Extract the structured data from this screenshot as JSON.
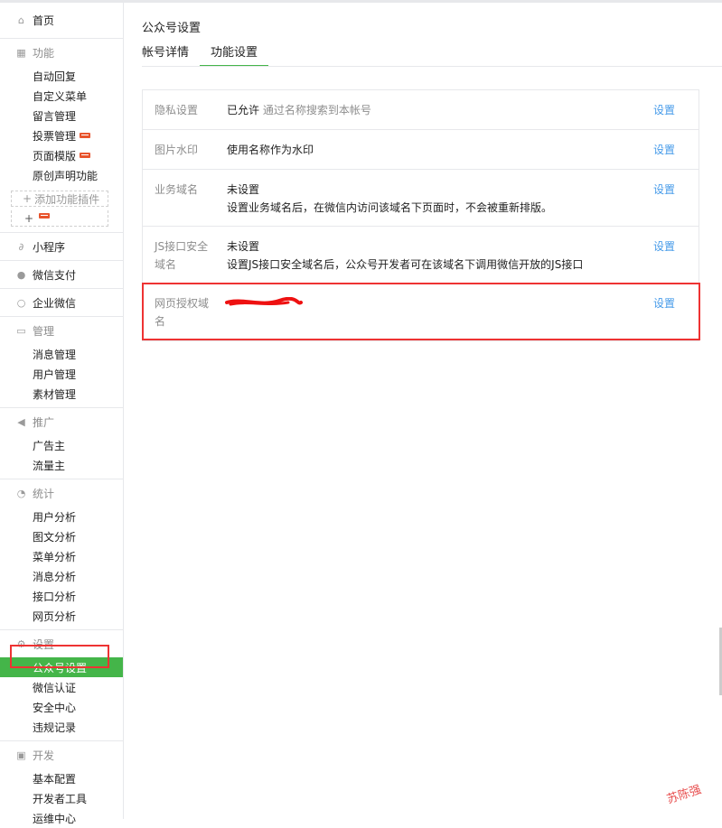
{
  "sidebar": {
    "home": {
      "label": "首页",
      "icon": "home-icon"
    },
    "features": {
      "label": "功能",
      "icon": "grid-icon",
      "items": [
        "自动回复",
        "自定义菜单",
        "留言管理",
        "投票管理",
        "页面模版",
        "原创声明功能"
      ],
      "add_plugin": "添加功能插件",
      "add_plus": "+"
    },
    "mini_program": {
      "label": "小程序",
      "icon": "link-icon"
    },
    "wechat_pay": {
      "label": "微信支付",
      "icon": "check-circle-icon"
    },
    "enterprise_wechat": {
      "label": "企业微信",
      "icon": "search-icon"
    },
    "manage": {
      "label": "管理",
      "icon": "inbox-icon",
      "items": [
        "消息管理",
        "用户管理",
        "素材管理"
      ]
    },
    "promote": {
      "label": "推广",
      "icon": "megaphone-icon",
      "items": [
        "广告主",
        "流量主"
      ]
    },
    "stats": {
      "label": "统计",
      "icon": "pie-chart-icon",
      "items": [
        "用户分析",
        "图文分析",
        "菜单分析",
        "消息分析",
        "接口分析",
        "网页分析"
      ]
    },
    "settings": {
      "label": "设置",
      "icon": "gear-icon",
      "items": [
        "公众号设置",
        "微信认证",
        "安全中心",
        "违规记录"
      ]
    },
    "develop": {
      "label": "开发",
      "icon": "code-icon",
      "items": [
        "基本配置",
        "开发者工具",
        "运维中心"
      ]
    }
  },
  "main": {
    "title": "公众号设置",
    "tabs": [
      "帐号详情",
      "功能设置"
    ],
    "rows": [
      {
        "label": "隐私设置",
        "value": "已允许",
        "value_note": "通过名称搜索到本帐号",
        "action": "设置"
      },
      {
        "label": "图片水印",
        "value": "使用名称作为水印",
        "action": "设置"
      },
      {
        "label": "业务域名",
        "value": "未设置",
        "desc": "设置业务域名后，在微信内访问该域名下页面时，不会被重新排版。",
        "action": "设置"
      },
      {
        "label": "JS接口安全域名",
        "value": "未设置",
        "desc": "设置JS接口安全域名后，公众号开发者可在该域名下调用微信开放的JS接口",
        "action": "设置"
      },
      {
        "label": "网页授权域名",
        "value": "",
        "action": "设置"
      }
    ]
  },
  "watermark": "苏陈强",
  "colors": {
    "accent": "#44b549",
    "link": "#459ae9",
    "highlight": "#ee3333",
    "badge": "#e8542d"
  }
}
